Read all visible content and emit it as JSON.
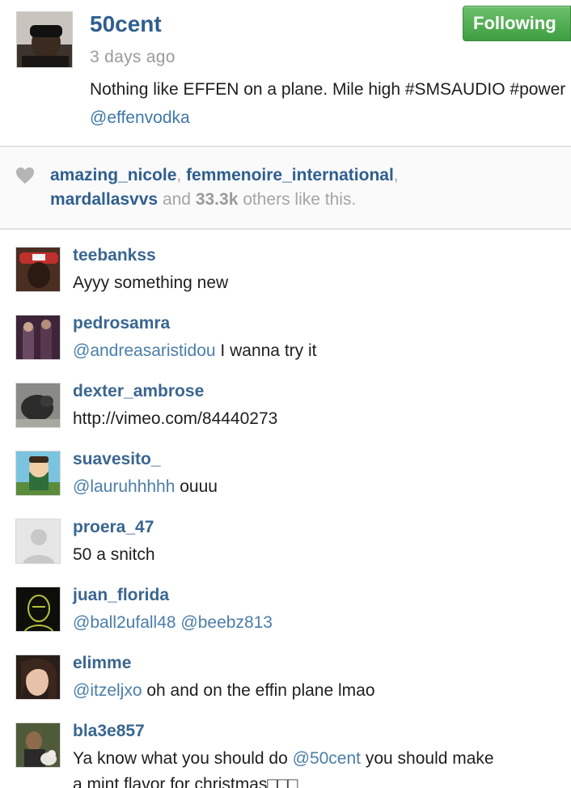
{
  "post": {
    "username": "50cent",
    "time": "3 days ago",
    "caption_text": "Nothing like EFFEN on a plane. Mile high #SMSAUDIO #power ",
    "caption_mention": "@effenvodka",
    "follow_label": "Following"
  },
  "likes": {
    "liker_1": "amazing_nicole",
    "liker_2": "femmenoire_international",
    "liker_3": "mardallasvvs",
    "and_word": " and ",
    "count": "33.3k",
    "suffix": " others like this."
  },
  "comments": [
    {
      "user": "teebankss",
      "mention": "",
      "text": "Ayyy something new"
    },
    {
      "user": "pedrosamra",
      "mention": "@andreasaristidou",
      "text": " I wanna try it"
    },
    {
      "user": "dexter_ambrose",
      "mention": "",
      "text": "http://vimeo.com/84440273"
    },
    {
      "user": "suavesito_",
      "mention": "@lauruhhhhh",
      "text": " ouuu"
    },
    {
      "user": "proera_47",
      "mention": "",
      "text": "50 a snitch"
    },
    {
      "user": "juan_florida",
      "mention": "@ball2ufall48 @beebz813",
      "text": ""
    },
    {
      "user": "elimme",
      "mention": "@itzeljxo",
      "text": " oh and on the effin plane lmao"
    },
    {
      "user": "bla3e857",
      "pre": "Ya know what you should do ",
      "mention": "@50cent",
      "text": " you should make",
      "line2": "a mint flavor for christmas□□□"
    }
  ],
  "icons": {
    "heart": "heart-icon",
    "default_avatar": "default-avatar-icon"
  },
  "colors": {
    "username_blue": "#2f5f8f",
    "mention_blue": "#3f78a8",
    "follow_green": "#4ca84e",
    "meta_gray": "#9a9a9a"
  }
}
